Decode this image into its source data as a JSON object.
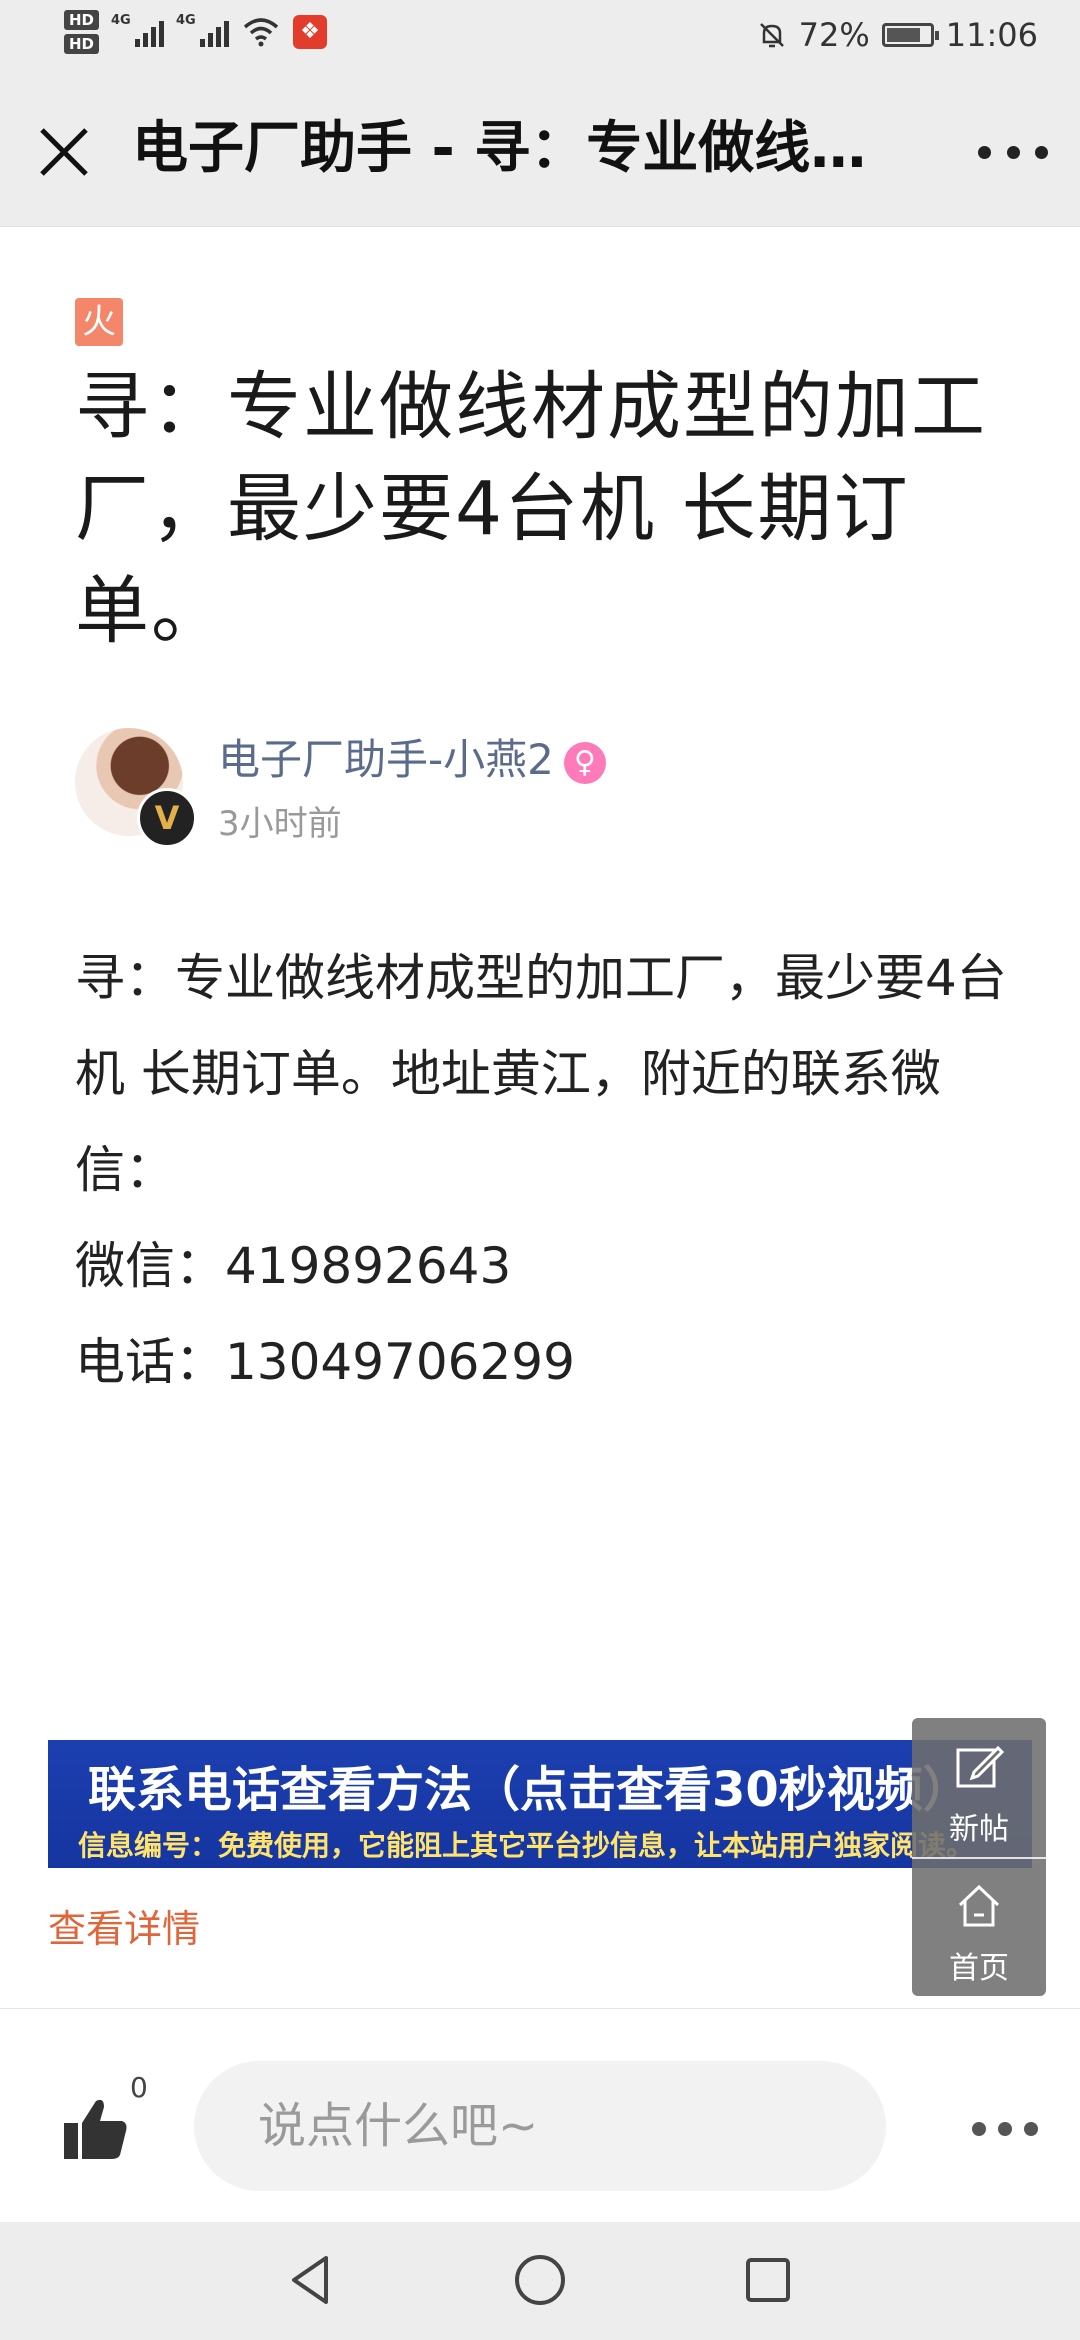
{
  "status_bar": {
    "hd1": "HD",
    "hd2": "HD",
    "net1": "4G",
    "net2": "4G",
    "battery_percent": "72%",
    "time": "11:06",
    "battery_level": 0.72
  },
  "titlebar": {
    "title": "电子厂助手 - 寻：专业做线…"
  },
  "article": {
    "hot_badge": "火",
    "title": "寻：专业做线材成型的加工厂，最少要4台机 长期订单。",
    "author": {
      "name": "电子厂助手-小燕2",
      "verified_badge": "V",
      "gender_badge": "♀",
      "time": "3小时前"
    },
    "body": {
      "paragraph": "寻：专业做线材成型的加工厂，最少要4台机 长期订单。地址黄江，附近的联系微信：",
      "wechat": "微信：419892643",
      "phone": "电话：13049706299"
    }
  },
  "banner": {
    "headline": "联系电话查看方法（点击查看30秒视频）",
    "subline": "信息编号：免费使用，它能阻上其它平台抄信息，让本站用户独家阅读。"
  },
  "detail_link": "查看详情",
  "float_menu": {
    "new_post": "新帖",
    "home": "首页"
  },
  "comment_bar": {
    "like_count": "0",
    "placeholder": "说点什么吧~"
  },
  "icons": {
    "close": "close-icon",
    "more": "more-icon",
    "like": "thumbs-up-icon",
    "edit": "edit-icon",
    "home": "home-icon",
    "back": "back-triangle-icon",
    "home_nav": "home-circle-icon",
    "recents": "recents-square-icon"
  },
  "colors": {
    "accent_orange": "#e0653a",
    "hot_badge": "#f4866a",
    "banner_blue": "#1c3fb0",
    "author_name": "#5b6b8c"
  }
}
